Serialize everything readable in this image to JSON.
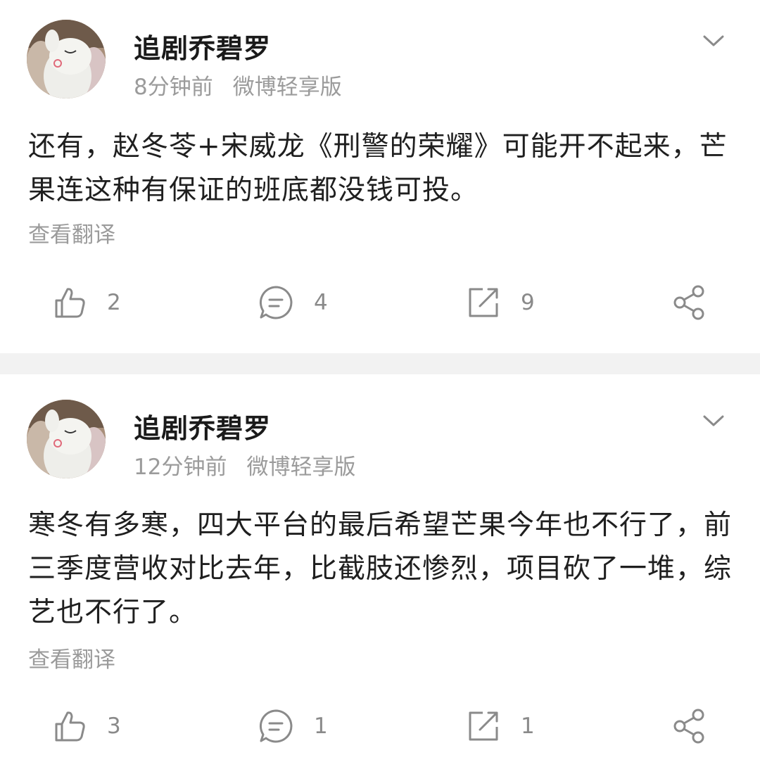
{
  "posts": [
    {
      "author": "追剧乔碧罗",
      "time": "8分钟前",
      "source": "微博轻享版",
      "text": "还有，赵冬苓+宋威龙《刑警的荣耀》可能开不起来，芒果连这种有保证的班底都没钱可投。",
      "translate_label": "查看翻译",
      "likes": "2",
      "comments": "4",
      "reposts": "9"
    },
    {
      "author": "追剧乔碧罗",
      "time": "12分钟前",
      "source": "微博轻享版",
      "text": "寒冬有多寒，四大平台的最后希望芒果今年也不行了，前三季度营收对比去年，比截肢还惨烈，项目砍了一堆，综艺也不行了。",
      "translate_label": "查看翻译",
      "likes": "3",
      "comments": "1",
      "reposts": "1"
    }
  ],
  "icons": {
    "like": "thumbs-up-icon",
    "comment": "comment-bubble-icon",
    "repost": "repost-icon",
    "share": "share-icon",
    "menu": "chevron-down-icon"
  },
  "colors": {
    "icon_gray": "#8a8a8a",
    "meta_gray": "#9b9b9b",
    "text": "#1f1f1f",
    "divider": "#f2f2f2"
  }
}
